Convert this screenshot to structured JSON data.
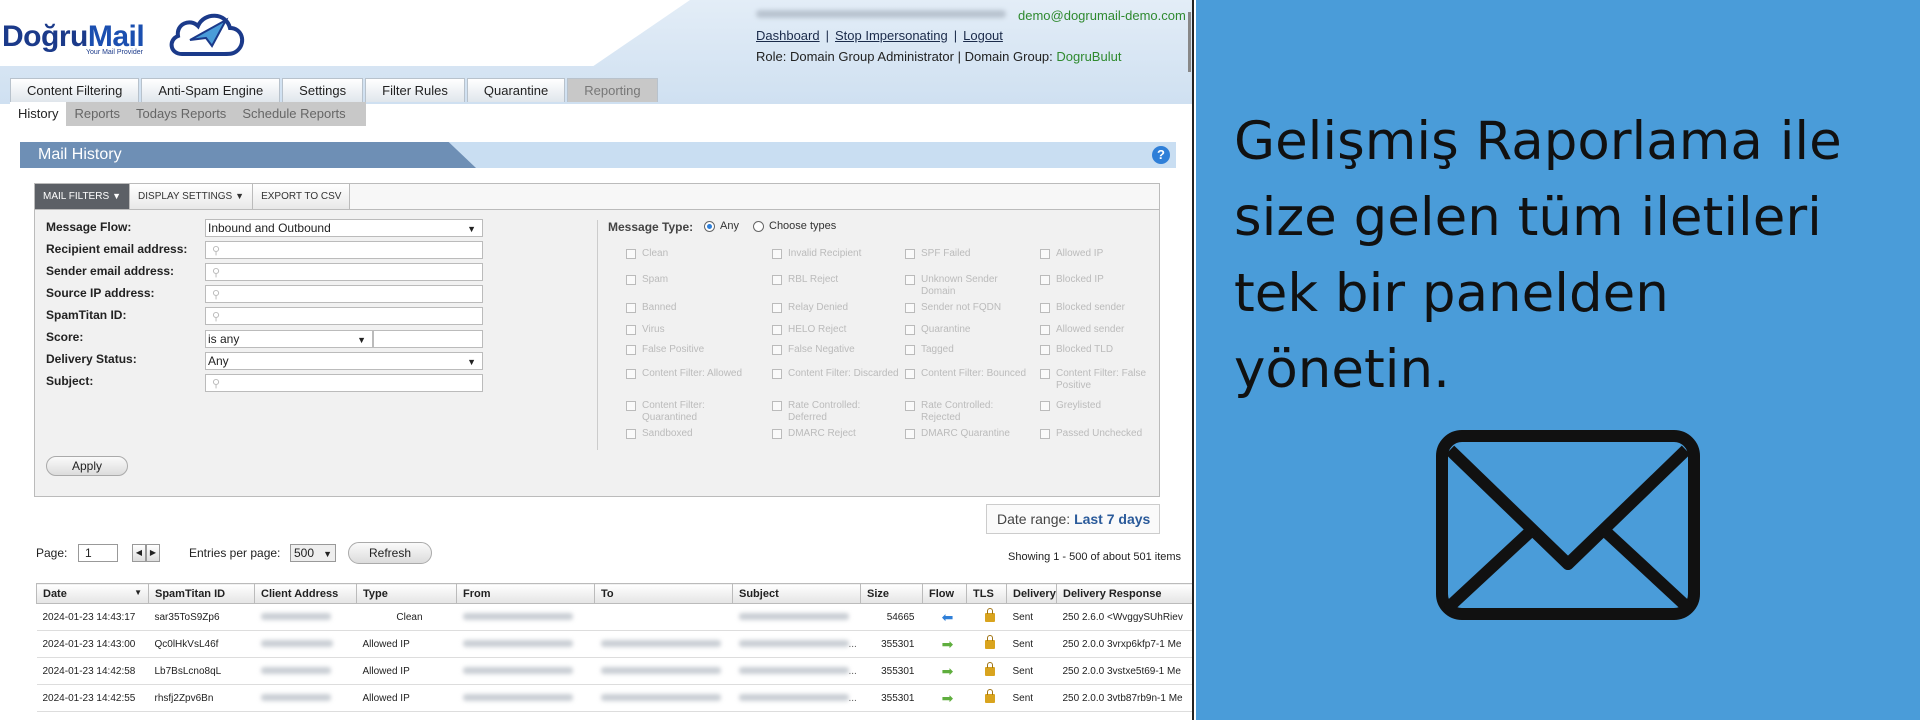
{
  "brand": {
    "name_part1": "Doğru",
    "name_part2": "Mail",
    "tagline": "Your Mail Provider"
  },
  "user": {
    "email": "demo@dogrumail-demo.com",
    "links": [
      "Dashboard",
      "Stop Impersonating",
      "Logout"
    ],
    "role_label": "Role: Domain Group Administrator",
    "group_label": "Domain Group:",
    "group_value": "DogruBulut"
  },
  "main_tabs": [
    "Content Filtering",
    "Anti-Spam Engine",
    "Settings",
    "Filter Rules",
    "Quarantine",
    "Reporting"
  ],
  "sub_tabs": [
    "History",
    "Reports",
    "Todays Reports",
    "Schedule Reports"
  ],
  "panel": {
    "title": "Mail History",
    "help": "?"
  },
  "filter_tabs": [
    "MAIL FILTERS",
    "DISPLAY SETTINGS",
    "EXPORT TO CSV"
  ],
  "filters": {
    "message_flow": {
      "label": "Message Flow:",
      "value": "Inbound and Outbound"
    },
    "recipient": {
      "label": "Recipient email address:"
    },
    "sender": {
      "label": "Sender email address:"
    },
    "source_ip": {
      "label": "Source IP address:"
    },
    "spamtitan_id": {
      "label": "SpamTitan ID:"
    },
    "score": {
      "label": "Score:",
      "value": "is any"
    },
    "delivery_status": {
      "label": "Delivery Status:",
      "value": "Any"
    },
    "subject": {
      "label": "Subject:"
    }
  },
  "message_type": {
    "label": "Message Type:",
    "any": "Any",
    "choose": "Choose types",
    "options": [
      [
        "Clean",
        "Invalid Recipient",
        "SPF Failed",
        "Allowed IP"
      ],
      [
        "Spam",
        "RBL Reject",
        "Unknown Sender Domain",
        "Blocked IP"
      ],
      [
        "Banned",
        "Relay Denied",
        "Sender not FQDN",
        "Blocked sender"
      ],
      [
        "Virus",
        "HELO Reject",
        "Quarantine",
        "Allowed sender"
      ],
      [
        "False Positive",
        "False Negative",
        "Tagged",
        "Blocked TLD"
      ],
      [
        "Content Filter: Allowed",
        "Content Filter: Discarded",
        "Content Filter: Bounced",
        "Content Filter: False Positive"
      ],
      [
        "Content Filter: Quarantined",
        "Rate Controlled: Deferred",
        "Rate Controlled: Rejected",
        "Greylisted"
      ],
      [
        "Sandboxed",
        "DMARC Reject",
        "DMARC Quarantine",
        "Passed Unchecked"
      ]
    ]
  },
  "apply_label": "Apply",
  "date_range": {
    "label": "Date range:",
    "value": "Last 7 days"
  },
  "pager": {
    "page_label": "Page:",
    "page_value": "1",
    "entries_label": "Entries per page:",
    "entries_value": "500",
    "refresh_label": "Refresh",
    "showing": "Showing 1 - 500 of about 501 items"
  },
  "table": {
    "headers": [
      "Date",
      "SpamTitan ID",
      "Client Address",
      "Type",
      "From",
      "To",
      "Subject",
      "Size",
      "Flow",
      "TLS",
      "Delivery",
      "Delivery Response"
    ],
    "rows": [
      {
        "date": "2024-01-23 14:43:17",
        "id": "sar35ToS9Zp6",
        "type": "Clean",
        "size": "54665",
        "flow": "in",
        "delivery": "Sent",
        "response": "250 2.6.0 <WvggySUhRiev"
      },
      {
        "date": "2024-01-23 14:43:00",
        "id": "Qc0lHkVsL46f",
        "type": "Allowed IP",
        "size": "355301",
        "flow": "out",
        "delivery": "Sent",
        "response": "250 2.0.0 3vrxp6kfp7-1 Me"
      },
      {
        "date": "2024-01-23 14:42:58",
        "id": "Lb7BsLcno8qL",
        "type": "Allowed IP",
        "size": "355301",
        "flow": "out",
        "delivery": "Sent",
        "response": "250 2.0.0 3vstxe5t69-1 Me"
      },
      {
        "date": "2024-01-23 14:42:55",
        "id": "rhsfj2Zpv6Bn",
        "type": "Allowed IP",
        "size": "355301",
        "flow": "out",
        "delivery": "Sent",
        "response": "250 2.0.0 3vtb87rb9n-1 Me"
      }
    ]
  },
  "promo": {
    "text": "Gelişmiş Raporlama ile size gelen tüm iletileri tek bir panelden yönetin.",
    "icon": "envelope-icon"
  }
}
